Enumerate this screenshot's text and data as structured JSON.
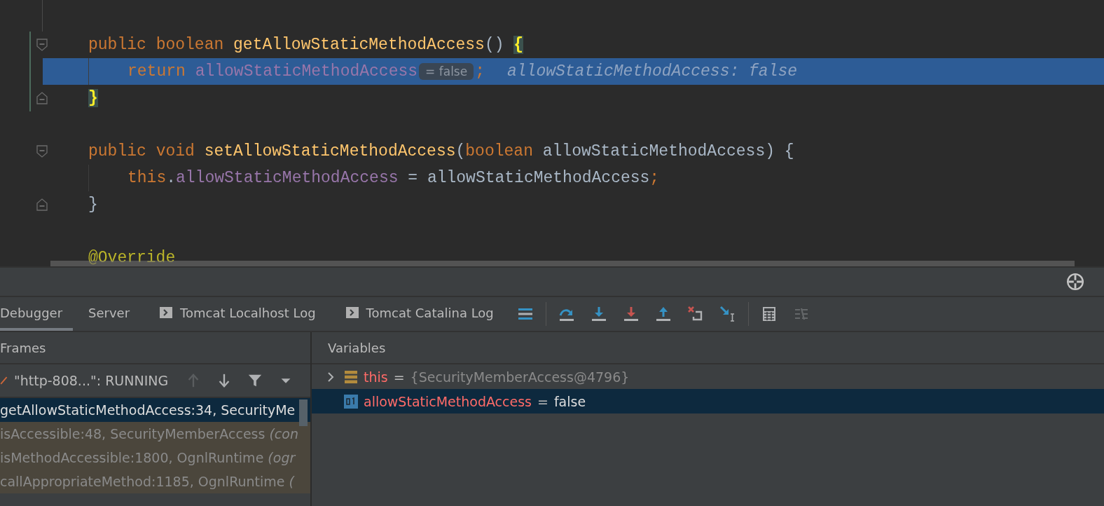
{
  "editor": {
    "lines": [
      {
        "kind": "fold-start",
        "current": false,
        "changed": true,
        "tokens": [
          {
            "t": "public ",
            "kind": "kw"
          },
          {
            "t": "boolean ",
            "kind": "kw"
          },
          {
            "t": "getAllowStaticMethodAccess",
            "kind": "method"
          },
          {
            "t": "() ",
            "kind": "plain"
          },
          {
            "t": "{",
            "kind": "brace-match"
          }
        ],
        "children": [
          {
            "kind": "plain",
            "current": true,
            "changed": true,
            "tokens": [
              {
                "t": "return ",
                "kind": "kw"
              },
              {
                "t": "allowStaticMethodAccess",
                "kind": "field"
              },
              {
                "t": "= false",
                "kind": "hint"
              },
              {
                "t": ";",
                "kind": "kw"
              },
              {
                "t": "allowStaticMethodAccess: false",
                "kind": "inline-value"
              }
            ]
          }
        ]
      },
      {
        "kind": "fold-end",
        "current": false,
        "changed": true,
        "tokens": [
          {
            "t": "}",
            "kind": "brace-match"
          }
        ]
      },
      {
        "kind": "plain",
        "current": false,
        "changed": false
      },
      {
        "kind": "fold-start",
        "current": false,
        "changed": false,
        "tokens": [
          {
            "t": "public ",
            "kind": "kw"
          },
          {
            "t": "void ",
            "kind": "kw"
          },
          {
            "t": "setAllowStaticMethodAccess",
            "kind": "method"
          },
          {
            "t": "(",
            "kind": "plain"
          },
          {
            "t": "boolean ",
            "kind": "kw"
          },
          {
            "t": "allowStaticMethodAccess) {",
            "kind": "plain"
          }
        ],
        "children": [
          {
            "kind": "plain",
            "current": false,
            "changed": false,
            "tokens": [
              {
                "t": "this",
                "kind": "kw"
              },
              {
                "t": ".",
                "kind": "plain"
              },
              {
                "t": "allowStaticMethodAccess",
                "kind": "field"
              },
              {
                "t": " = allowStaticMethodAccess",
                "kind": "plain"
              },
              {
                "t": ";",
                "kind": "kw"
              }
            ]
          }
        ]
      },
      {
        "kind": "fold-end",
        "current": false,
        "changed": false,
        "tokens": [
          {
            "t": "}",
            "kind": "plain"
          }
        ]
      },
      {
        "kind": "plain",
        "current": false,
        "changed": false
      },
      {
        "kind": "plain",
        "current": false,
        "changed": false,
        "tokens": [
          {
            "t": "@Override",
            "kind": "annotation"
          }
        ]
      }
    ]
  },
  "tabs": [
    {
      "label": "Debugger",
      "selected": true,
      "kind": "plain"
    },
    {
      "label": "Server",
      "selected": false,
      "kind": "plain"
    },
    {
      "label": "Tomcat Localhost Log",
      "selected": false,
      "kind": "console"
    },
    {
      "label": "Tomcat Catalina Log",
      "selected": false,
      "kind": "console"
    }
  ],
  "toolbar": [
    {
      "kind": "layout",
      "disabled": false
    },
    {
      "kind": "step-over",
      "disabled": false
    },
    {
      "kind": "step-into",
      "disabled": false
    },
    {
      "kind": "force-step-into",
      "disabled": false
    },
    {
      "kind": "step-out",
      "disabled": false
    },
    {
      "kind": "drop-frame",
      "disabled": false
    },
    {
      "kind": "run-to-cursor",
      "disabled": false
    },
    {
      "kind": "evaluate",
      "disabled": false
    },
    {
      "kind": "trace",
      "disabled": true
    }
  ],
  "frames": {
    "title": "Frames",
    "thread": "\"http-808...\": RUNNING",
    "buttons": [
      {
        "kind": "up",
        "disabled": true
      },
      {
        "kind": "down",
        "disabled": false
      },
      {
        "kind": "filter",
        "disabled": false
      },
      {
        "kind": "caret",
        "disabled": false
      }
    ],
    "items": [
      {
        "text": "getAllowStaticMethodAccess:34, SecurityMe",
        "selected": true,
        "library": false
      },
      {
        "text": "isAccessible:48, SecurityMemberAccess *(con*",
        "selected": false,
        "library": true
      },
      {
        "text": "isMethodAccessible:1800, OgnlRuntime *(ogr*",
        "selected": false,
        "library": true
      },
      {
        "text": "callAppropriateMethod:1185, OgnlRuntime *(*",
        "selected": false,
        "library": true
      }
    ]
  },
  "variables": {
    "title": "Variables",
    "items": [
      {
        "kind": "object",
        "name": "this",
        "equals": "=",
        "value": "{SecurityMemberAccess@4796}",
        "expandable": true,
        "selected": false
      },
      {
        "kind": "primitive",
        "name": "allowStaticMethodAccess",
        "equals": "=",
        "value": "false",
        "expandable": false,
        "selected": true
      }
    ]
  }
}
